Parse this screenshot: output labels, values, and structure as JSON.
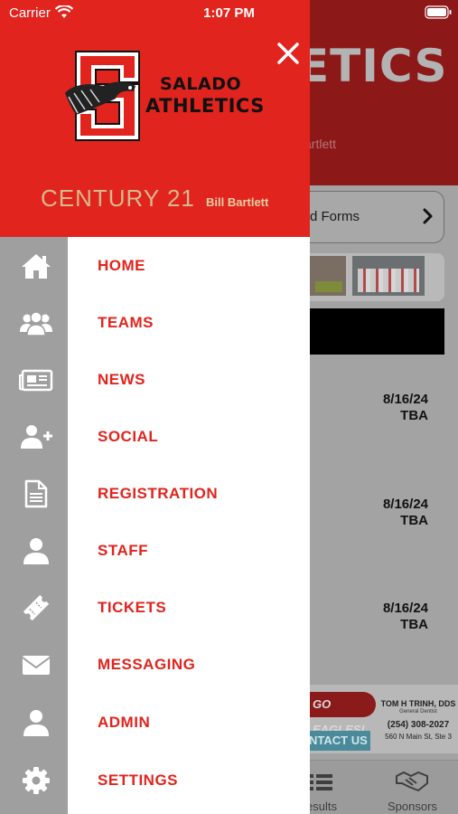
{
  "status_bar": {
    "carrier": "Carrier",
    "time": "1:07 PM"
  },
  "background": {
    "title_fragment": "ETICS",
    "sponsor_fragment": "artlett",
    "forms_label": "d Forms",
    "events": [
      {
        "date": "8/16/24",
        "time": "TBA"
      },
      {
        "date": "8/16/24",
        "time": "TBA"
      },
      {
        "date": "8/16/24",
        "time": "TBA"
      }
    ],
    "ad": {
      "slogan": "GO EAGLES!",
      "doctor": "TOM H TRINH, DDS",
      "specialty": "General Dentist",
      "phone": "(254) 308-2027",
      "address": "560 N Main St, Ste 3",
      "cta": "NTACT US"
    },
    "tabs": {
      "results": "esults",
      "sponsors": "Sponsors"
    }
  },
  "drawer": {
    "logo": {
      "line1": "SALADO",
      "line2": "ATHLETICS"
    },
    "sponsor": {
      "brand": "CENTURY 21",
      "agent": "Bill Bartlett"
    },
    "menu": [
      {
        "label": "HOME",
        "icon": "home-icon"
      },
      {
        "label": "TEAMS",
        "icon": "group-icon"
      },
      {
        "label": "NEWS",
        "icon": "newspaper-icon"
      },
      {
        "label": "SOCIAL",
        "icon": "add-user-icon"
      },
      {
        "label": "REGISTRATION",
        "icon": "document-icon"
      },
      {
        "label": "STAFF",
        "icon": "person-icon"
      },
      {
        "label": "TICKETS",
        "icon": "ticket-icon"
      },
      {
        "label": "MESSAGING",
        "icon": "envelope-icon"
      },
      {
        "label": "ADMIN",
        "icon": "admin-person-icon"
      },
      {
        "label": "SETTINGS",
        "icon": "gear-icon"
      }
    ]
  },
  "colors": {
    "brand_red": "#e1241d",
    "rail_gray": "#9f9f9f",
    "sponsor_gold": "#d6b98c"
  }
}
